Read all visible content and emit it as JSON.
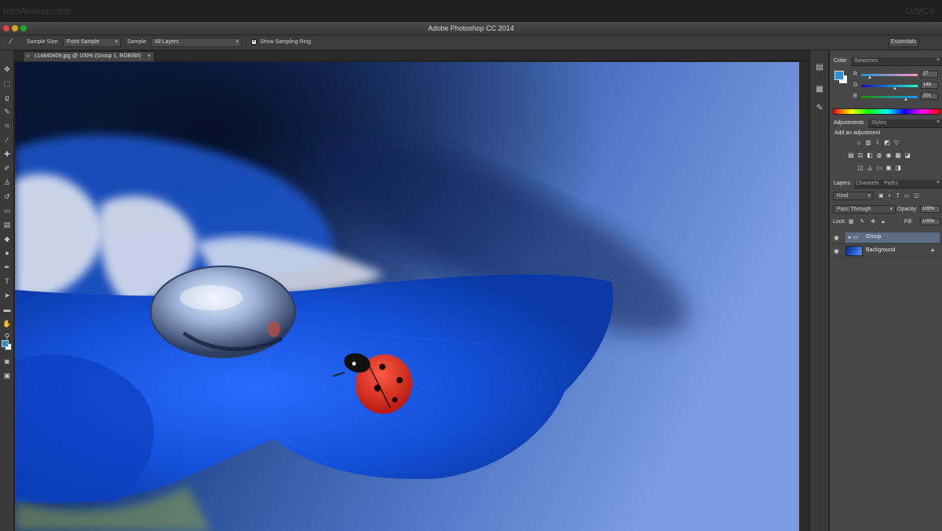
{
  "watermark": {
    "left": "fotoAlonar.com",
    "right": "UdzCo"
  },
  "titlebar": {
    "title": "Adobe Photoshop CC 2014"
  },
  "options_bar": {
    "tool_icon": "eyedropper-icon",
    "sample_size_label": "Sample Size:",
    "sample_size_value": "Point Sample",
    "sample_label": "Sample:",
    "sample_value": "All Layers",
    "show_ring_label": "Show Sampling Ring",
    "workspace": "Essentials"
  },
  "document": {
    "tab_title": "c14840409.jpg @ 100% (Group 1, RGB/8#)"
  },
  "color_panel": {
    "tabs": [
      "Color",
      "Swatches"
    ],
    "sliders": [
      {
        "label": "R",
        "value": "27"
      },
      {
        "label": "G",
        "value": "148"
      },
      {
        "label": "B",
        "value": "201"
      }
    ],
    "foreground": "#2f8fd6"
  },
  "adjustments_panel": {
    "tabs": [
      "Adjustments",
      "Styles"
    ],
    "heading": "Add an adjustment"
  },
  "layers_panel": {
    "tabs": [
      "Layers",
      "Channels",
      "Paths"
    ],
    "filter_kind": "Kind",
    "blend_mode": "Pass Through",
    "opacity_label": "Opacity:",
    "opacity_value": "100%",
    "lock_label": "Lock:",
    "fill_label": "Fill:",
    "fill_value": "100%",
    "layers": [
      {
        "name": "Group",
        "type": "group",
        "selected": true
      },
      {
        "name": "Background",
        "type": "image",
        "selected": false
      }
    ]
  }
}
